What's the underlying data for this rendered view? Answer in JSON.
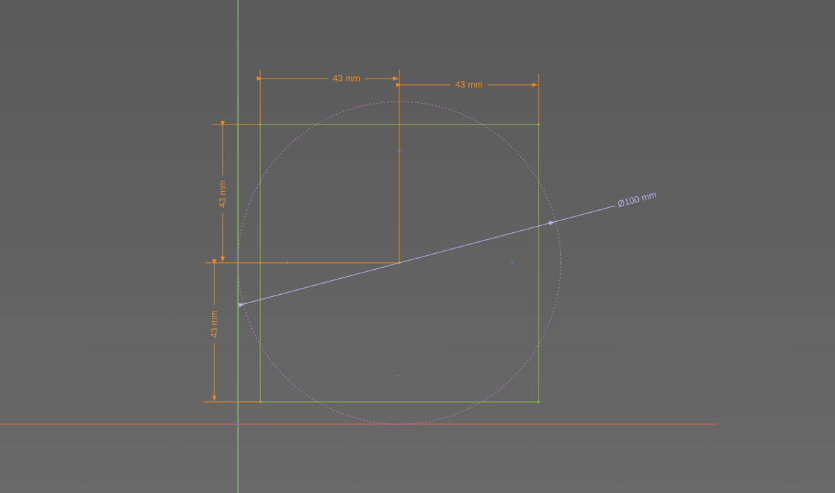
{
  "colors": {
    "background": "#626262",
    "dimension": "#f28a1c",
    "rectangle": "#8fc23a",
    "circle": "#c77ad6",
    "diameter": "#b9b4f0",
    "axis_x": "#d96a4e",
    "axis_y": "#7ed95a",
    "point": "#4a86d8"
  },
  "dimensions": {
    "top_left": "43 mm",
    "top_right": "43 mm",
    "left_upper": "43 mm",
    "left_lower": "43 mm",
    "diameter": "Ø100 mm"
  }
}
